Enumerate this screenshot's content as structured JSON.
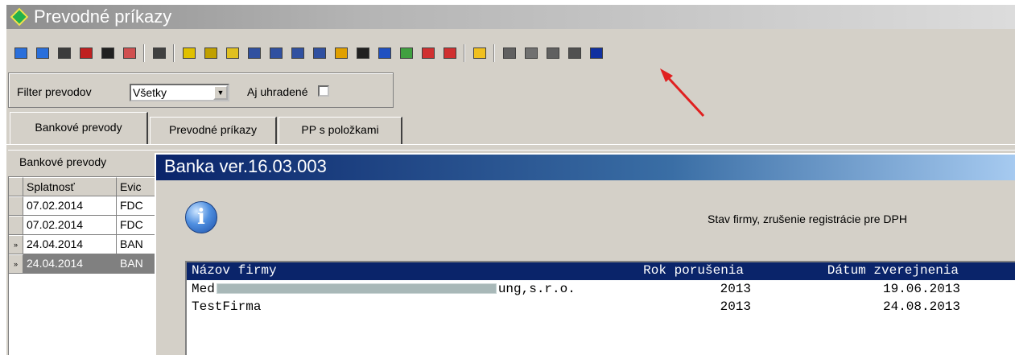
{
  "window": {
    "title": "Prevodné príkazy"
  },
  "toolbar": {
    "icons": [
      "save-icon",
      "window-icon",
      "calculator-icon",
      "grid-icon",
      "bin-icon",
      "edit-icon",
      "print-icon",
      "filter-icon",
      "clear-filter-icon",
      "find-icon",
      "first-icon",
      "prev-icon",
      "next-icon",
      "last-icon",
      "copy-icon",
      "sum-icon",
      "export-icon",
      "report-icon",
      "import-icon",
      "flag-icon",
      "bank-check-icon",
      "calc2-icon",
      "book-icon",
      "form-icon",
      "tools-icon",
      "eu-icon"
    ]
  },
  "filter": {
    "label": "Filter prevodov",
    "selected": "Všetky",
    "paid_label": "Aj uhradené"
  },
  "tabs": [
    {
      "label": "Bankové prevody"
    },
    {
      "label": "Prevodné príkazy"
    },
    {
      "label": "PP s položkami"
    }
  ],
  "panel": {
    "title": "Bankové prevody"
  },
  "grid": {
    "headers": [
      "Splatnosť",
      "Evic"
    ],
    "rows": [
      {
        "indicator": "",
        "date": "07.02.2014",
        "code": "FDC"
      },
      {
        "indicator": "",
        "date": "07.02.2014",
        "code": "FDC"
      },
      {
        "indicator": "»",
        "date": "24.04.2014",
        "code": "BAN"
      },
      {
        "indicator": "»",
        "date": "24.04.2014",
        "code": "BAN"
      }
    ]
  },
  "dialog": {
    "title": "Banka ver.16.03.003",
    "message": "Stav firmy, zrušenie registrácie pre DPH",
    "table": {
      "headers": [
        "Názov firmy",
        "Rok porušenia",
        "Dátum zverejnenia"
      ],
      "rows": [
        {
          "name_start": "Med",
          "name_end": "ung,s.r.o.",
          "year": "2013",
          "date": "19.06.2013"
        },
        {
          "name_start": "TestFirma",
          "name_end": "",
          "year": "2013",
          "date": "24.08.2013"
        }
      ]
    }
  },
  "colors": {
    "dialog_title": "#0a246a",
    "annotation_arrow": "#e02020"
  }
}
